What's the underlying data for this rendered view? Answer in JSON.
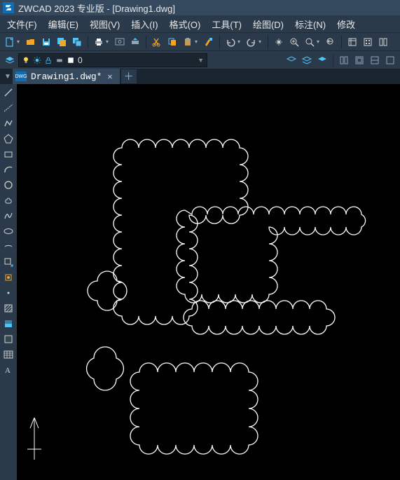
{
  "title": "ZWCAD 2023 专业版 - [Drawing1.dwg]",
  "menus": {
    "file": "文件(F)",
    "edit": "编辑(E)",
    "view": "视图(V)",
    "insert": "插入(I)",
    "format": "格式(O)",
    "tools": "工具(T)",
    "draw": "绘图(D)",
    "dim": "标注(N)",
    "modify": "修改"
  },
  "layer": {
    "name": "0"
  },
  "tab": {
    "filename": "Drawing1.dwg*"
  }
}
